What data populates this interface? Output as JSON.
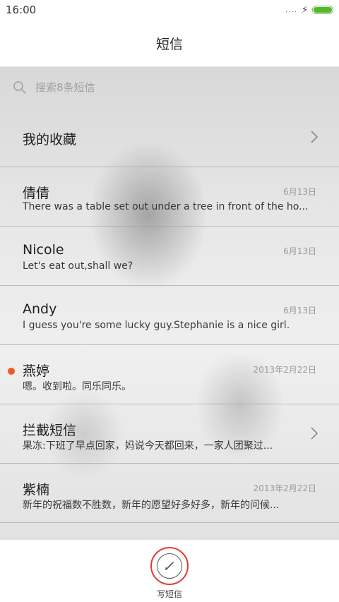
{
  "status_bar": {
    "time": "16:00",
    "signal": "....",
    "charging_symbol": "⚡",
    "battery_level": 1.0,
    "battery_color": "#58b52e"
  },
  "header": {
    "title": "短信"
  },
  "search": {
    "placeholder": "搜索8条短信"
  },
  "conversations": [
    {
      "name": "我的收藏",
      "date": "",
      "preview": "",
      "unread": false,
      "has_chevron": true
    },
    {
      "name": "倩倩",
      "date": "6月13日",
      "preview": "There was a table set out under a tree in front of the ho...",
      "unread": false,
      "has_chevron": false
    },
    {
      "name": "Nicole",
      "date": "6月13日",
      "preview": "Let's eat out,shall we?",
      "unread": false,
      "has_chevron": false
    },
    {
      "name": "Andy",
      "date": "6月13日",
      "preview": "I guess you're some lucky guy.Stephanie is a nice girl.",
      "unread": false,
      "has_chevron": false
    },
    {
      "name": "燕婷",
      "date": "2013年2月22日",
      "preview": "嗯。收到啦。同乐同乐。",
      "unread": true,
      "has_chevron": false
    },
    {
      "name": "拦截短信",
      "date": "",
      "preview": "果冻:下班了早点回家，妈说今天都回来，一家人团聚过...",
      "unread": false,
      "has_chevron": true
    },
    {
      "name": "紫楠",
      "date": "2013年2月22日",
      "preview": "新年的祝福数不胜数，新年的愿望好多好多，新年的问候...",
      "unread": false,
      "has_chevron": false
    }
  ],
  "bottom_bar": {
    "compose_label": "写短信",
    "accent_color": "#e33a3a"
  },
  "colors": {
    "unread_dot": "#ef5a1e"
  }
}
